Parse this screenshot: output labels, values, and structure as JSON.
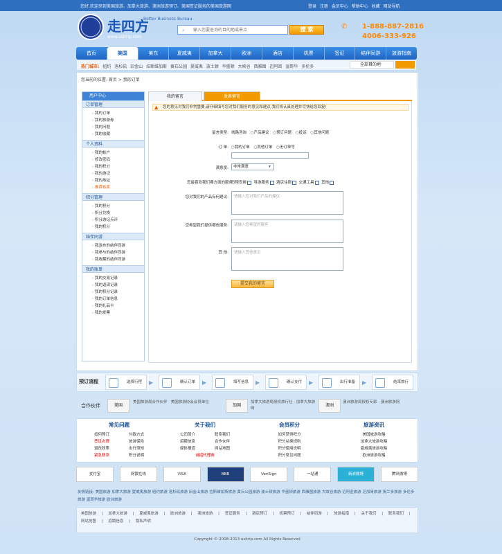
{
  "topbar": {
    "left": "您好,欢迎来到美国旅游、加拿大旅游、澳洲旅游预订、美国签证服务的美国旅游网",
    "right": "登录 注册 会员中心 帮助中心 收藏 网站导航"
  },
  "header": {
    "logo_text": "走四方",
    "slogan": "Better Business Bureau",
    "logo_url": "www.usitrip.com",
    "search_placeholder": "输入您要查询的目的地或景点",
    "search_btn": "搜 索",
    "hotline1": "1-888-887-2816",
    "hotline2": "4006-333-926"
  },
  "nav": [
    "首页",
    "美国",
    "美东",
    "夏威夷",
    "加拿大",
    "欧洲",
    "酒店",
    "机票",
    "签证",
    "结伴同游",
    "旅游指南"
  ],
  "subnav": {
    "label": "热门城市:",
    "items": "纽约 洛杉矶 旧金山 拉斯维加斯 黄石公园 夏威夷 波士顿 华盛顿 大峡谷 西雅图 迈阿密 温哥华 多伦多",
    "select": "全部目的地"
  },
  "crumb": "您当前的位置: 首页 > 我的订单",
  "sidebar": {
    "head": "用户中心",
    "sections": [
      {
        "title": "订单管理",
        "items": [
          "我的订单",
          "我的旅游券",
          "我的问题",
          "我的收藏"
        ]
      },
      {
        "title": "个人资料",
        "items": [
          "我的帐户",
          "修改密码",
          "我的积分",
          "我的游记",
          "我的地址",
          "推荐有奖"
        ]
      },
      {
        "title": "积分管理",
        "items": [
          "我的积分",
          "积分兑换",
          "积分游记点评",
          "我的积分"
        ]
      },
      {
        "title": "结伴同游",
        "items": [
          "我发布的结伴同游",
          "我参与的结伴同游",
          "我收藏的结伴同游"
        ]
      },
      {
        "title": "我的账单",
        "items": [
          "我的交易记录",
          "我的返现记录",
          "我的积分记录",
          "我的订单信息",
          "我的礼品卡",
          "我的发票"
        ]
      }
    ]
  },
  "tabs": {
    "t1": "我的留言",
    "t2": "发表留言"
  },
  "notice": "您的意见对我们非常重要,请仔细填写您对我们服务的意见和建议,我们将认真处理并尽快给您回复!",
  "form": {
    "q1_label": "留言类型:",
    "q1_opts": "线路咨询 ○产品建议 ○预订问题 ○投诉 ○其他问题",
    "q2_label": "订 单:",
    "q2_opts": "○我的订单 ○其他订单 ○无订单号",
    "q3_label": "满意度:",
    "q3_value": "非常满意",
    "q4_label": "您最喜欢我们哪方面的服务:",
    "q4_opts": [
      "行程安排",
      "导游服务",
      "酒店住宿",
      "交通工具",
      "其他"
    ],
    "q5_label": "您对我们的产品有何建议:",
    "q5_ph": "请输入您对我们产品的建议",
    "q6_label": "您希望我们提供哪些服务:",
    "q6_ph": "请输入您希望的服务",
    "q7_label": "其 他:",
    "q7_ph": "请输入其他意见",
    "submit": "提交我的留言"
  },
  "steps": {
    "title": "预订流程",
    "items": [
      "选择行程",
      "确认订单",
      "填写信息",
      "确认支付",
      "出行准备",
      "结束旅行"
    ]
  },
  "partners": {
    "title": "合作伙伴",
    "logos": [
      "美国",
      "加国",
      "澳洲"
    ],
    "texts": [
      "美国旅游局合作伙伴 · 美国旅游协会会员单位",
      "加拿大旅游局授权旅行社 · 加拿大旅游网",
      "澳洲旅游局授权专家 · 澳洲旅游网"
    ]
  },
  "help": [
    {
      "h": "常见问题",
      "items": [
        "如何预订",
        "付款方式",
        "签证办理",
        "旅游保险",
        "退改政策",
        "出行须知",
        "紧急联系",
        "积分说明"
      ]
    },
    {
      "h": "关于我们",
      "items": [
        "公司简介",
        "联系我们",
        "招聘信息",
        "合作伙伴",
        "媒体报道",
        "网站地图",
        "诚招代理商"
      ]
    },
    {
      "h": "会员积分",
      "items": [
        "如何获得积分",
        "积分兑换规则",
        "积分使用说明",
        "积分常见问题"
      ]
    },
    {
      "h": "旅游资讯",
      "items": [
        "美国旅游攻略",
        "加拿大旅游攻略",
        "夏威夷旅游攻略",
        "欧洲旅游攻略"
      ]
    }
  ],
  "certs": [
    "支付宝",
    "网银在线",
    "VISA",
    "BBB",
    "VeriSign",
    "一站通",
    "新浪微博",
    "腾讯微博"
  ],
  "flinks": "友情链接: 美国旅游 加拿大旅游 夏威夷旅游 纽约旅游 洛杉矶旅游 旧金山旅游 拉斯维加斯旅游 黄石公园旅游 波士顿旅游 华盛顿旅游 西雅图旅游 大峡谷旅游 迈阿密旅游 芝加哥旅游 奥兰多旅游 多伦多旅游 温哥华旅游 欧洲旅游",
  "bottom": "美国旅游 | 加拿大旅游 | 夏威夷旅游 | 欧洲旅游 | 澳洲旅游 | 签证服务 | 酒店预订 | 机票预订 | 结伴同游 | 旅游指南 | 关于我们 | 联系我们 | 网站地图 | 招聘信息 | 隐私声明",
  "copy": "Copyright © 2008-2013 usitrip.com All Rights Reserved"
}
